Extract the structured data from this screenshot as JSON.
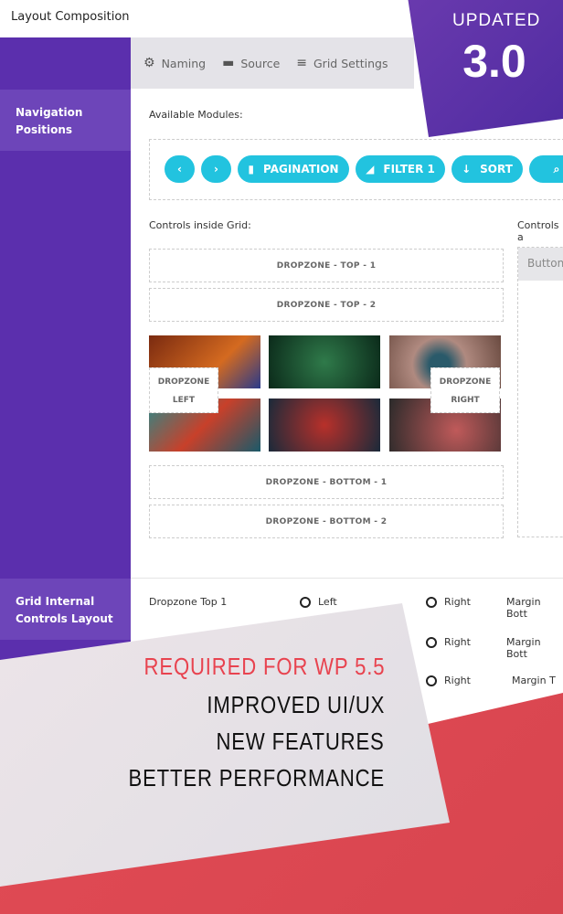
{
  "header": {
    "title": "Layout Composition"
  },
  "sidebar": {
    "items": [
      {
        "label": "Navigation Positions"
      },
      {
        "label": "Grid Internal Controls Layout"
      }
    ]
  },
  "tabs": [
    {
      "label": "Naming",
      "icon": "gear-icon"
    },
    {
      "label": "Source",
      "icon": "folder-icon"
    },
    {
      "label": "Grid Settings",
      "icon": "menu-icon"
    }
  ],
  "badge": {
    "line1": "UPDATED",
    "version": "3.0"
  },
  "modules": {
    "label": "Available Modules:",
    "items": [
      {
        "label": "‹",
        "icon": "chevron-left-icon"
      },
      {
        "label": "›",
        "icon": "chevron-right-icon"
      },
      {
        "label": "PAGINATION",
        "icon": "file-icon"
      },
      {
        "label": "FILTER 1",
        "icon": "bullhorn-icon"
      },
      {
        "label": "SORT",
        "icon": "sort-alpha-icon"
      },
      {
        "label": "",
        "icon": "search-icon"
      }
    ]
  },
  "grid": {
    "inside_label": "Controls inside Grid:",
    "outside_label": "Controls a",
    "button_label": "Button",
    "dropzones": [
      "DROPZONE - TOP - 1",
      "DROPZONE - TOP - 2",
      "DROPZONE - BOTTOM - 1",
      "DROPZONE - BOTTOM - 2"
    ],
    "left": [
      "DROPZONE",
      "LEFT"
    ],
    "right": [
      "DROPZONE",
      "RIGHT"
    ]
  },
  "layout_rows": [
    {
      "name": "Dropzone Top 1",
      "opt1": "Left",
      "opt2": "Right",
      "margin": "Margin Bott"
    },
    {
      "opt2": "Right",
      "margin": "Margin Bott"
    },
    {
      "opt2": "Right",
      "margin": "Margin T"
    }
  ],
  "promo": {
    "required": "REQUIRED FOR WP 5.5",
    "lines": [
      "IMPROVED UI/UX",
      "NEW FEATURES",
      "BETTER PERFORMANCE"
    ],
    "accent": "#e8434f"
  }
}
